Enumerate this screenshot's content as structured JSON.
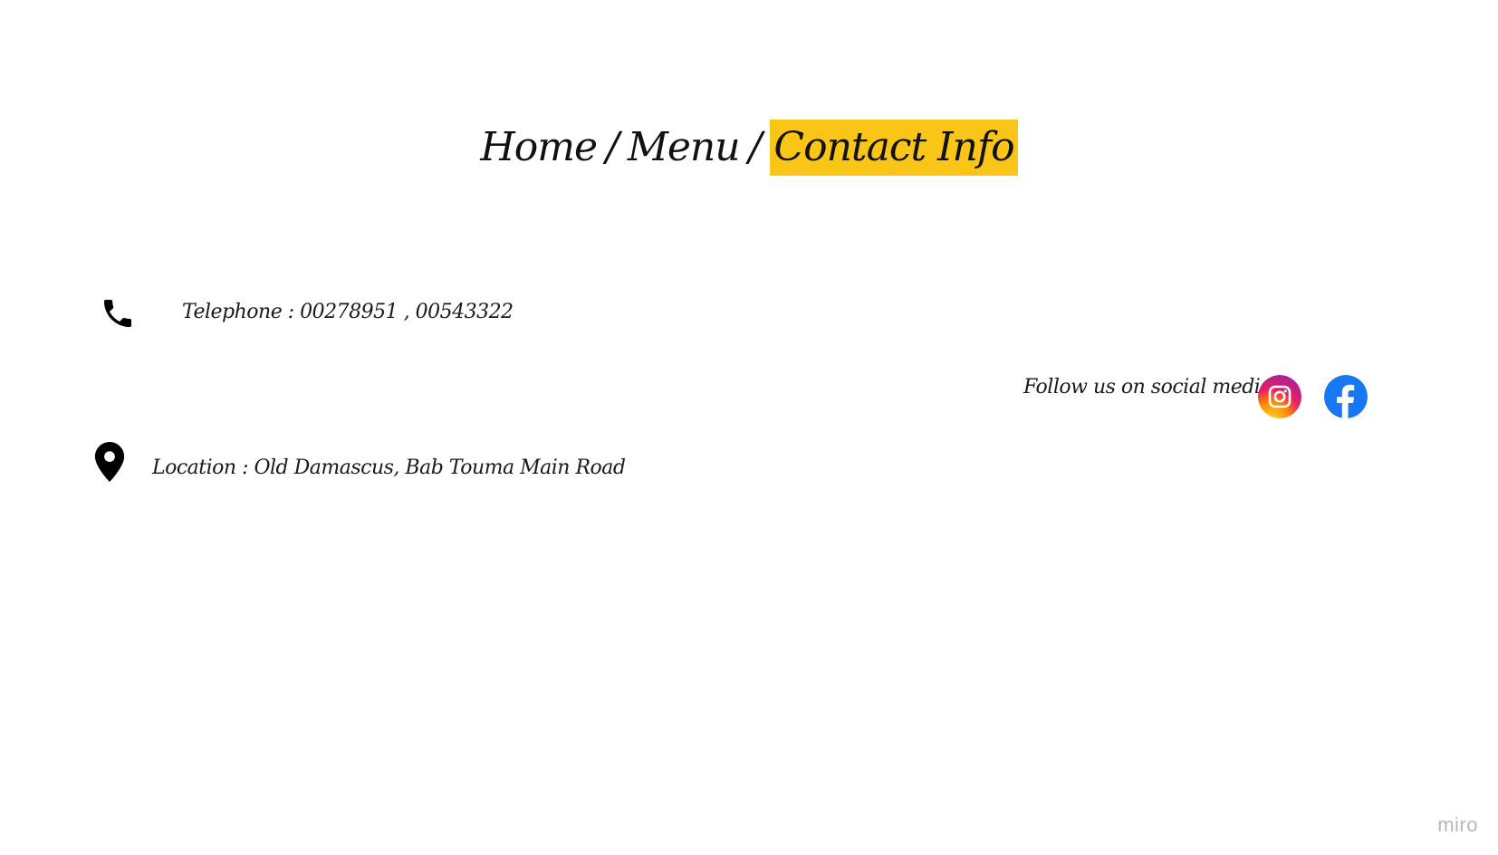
{
  "nav": {
    "home": "Home",
    "separator": "/",
    "menu": "Menu",
    "contact": "Contact Info",
    "highlight_color": "#f9c617"
  },
  "contact": {
    "telephone": "Telephone : 00278951 , 00543322",
    "location": "Location :  Old Damascus, Bab Touma Main Road",
    "phone_icon": "phone-icon",
    "location_icon": "map-pin-icon"
  },
  "social": {
    "label": "Follow us on social  media :",
    "instagram_icon": "instagram-icon",
    "facebook_icon": "facebook-icon",
    "facebook_color": "#1877f2"
  },
  "watermark": "miro"
}
